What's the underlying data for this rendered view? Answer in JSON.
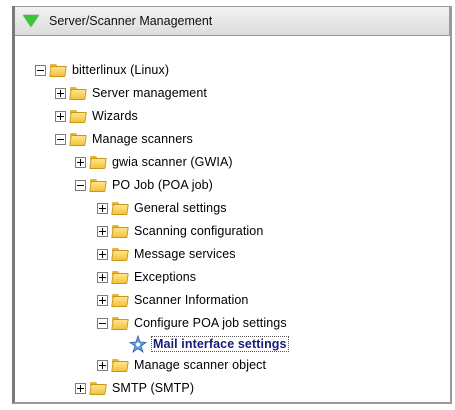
{
  "panel": {
    "title": "Server/Scanner Management"
  },
  "tree": {
    "root": "bitterlinux (Linux)",
    "server_management": "Server management",
    "wizards": "Wizards",
    "manage_scanners": "Manage scanners",
    "gwia_scanner": "gwia scanner (GWIA)",
    "po_job": "PO Job (POA job)",
    "general_settings": "General settings",
    "scanning_configuration": "Scanning configuration",
    "message_services": "Message services",
    "exceptions": "Exceptions",
    "scanner_information": "Scanner Information",
    "configure_poa_job_settings": "Configure POA job settings",
    "mail_interface_settings": "Mail interface settings",
    "manage_scanner_object": "Manage scanner object",
    "smtp": "SMTP (SMTP)"
  },
  "colors": {
    "header_arrow": "#3cc43c",
    "folder": "#f2c33d",
    "selected_text": "#1a1a7a"
  }
}
